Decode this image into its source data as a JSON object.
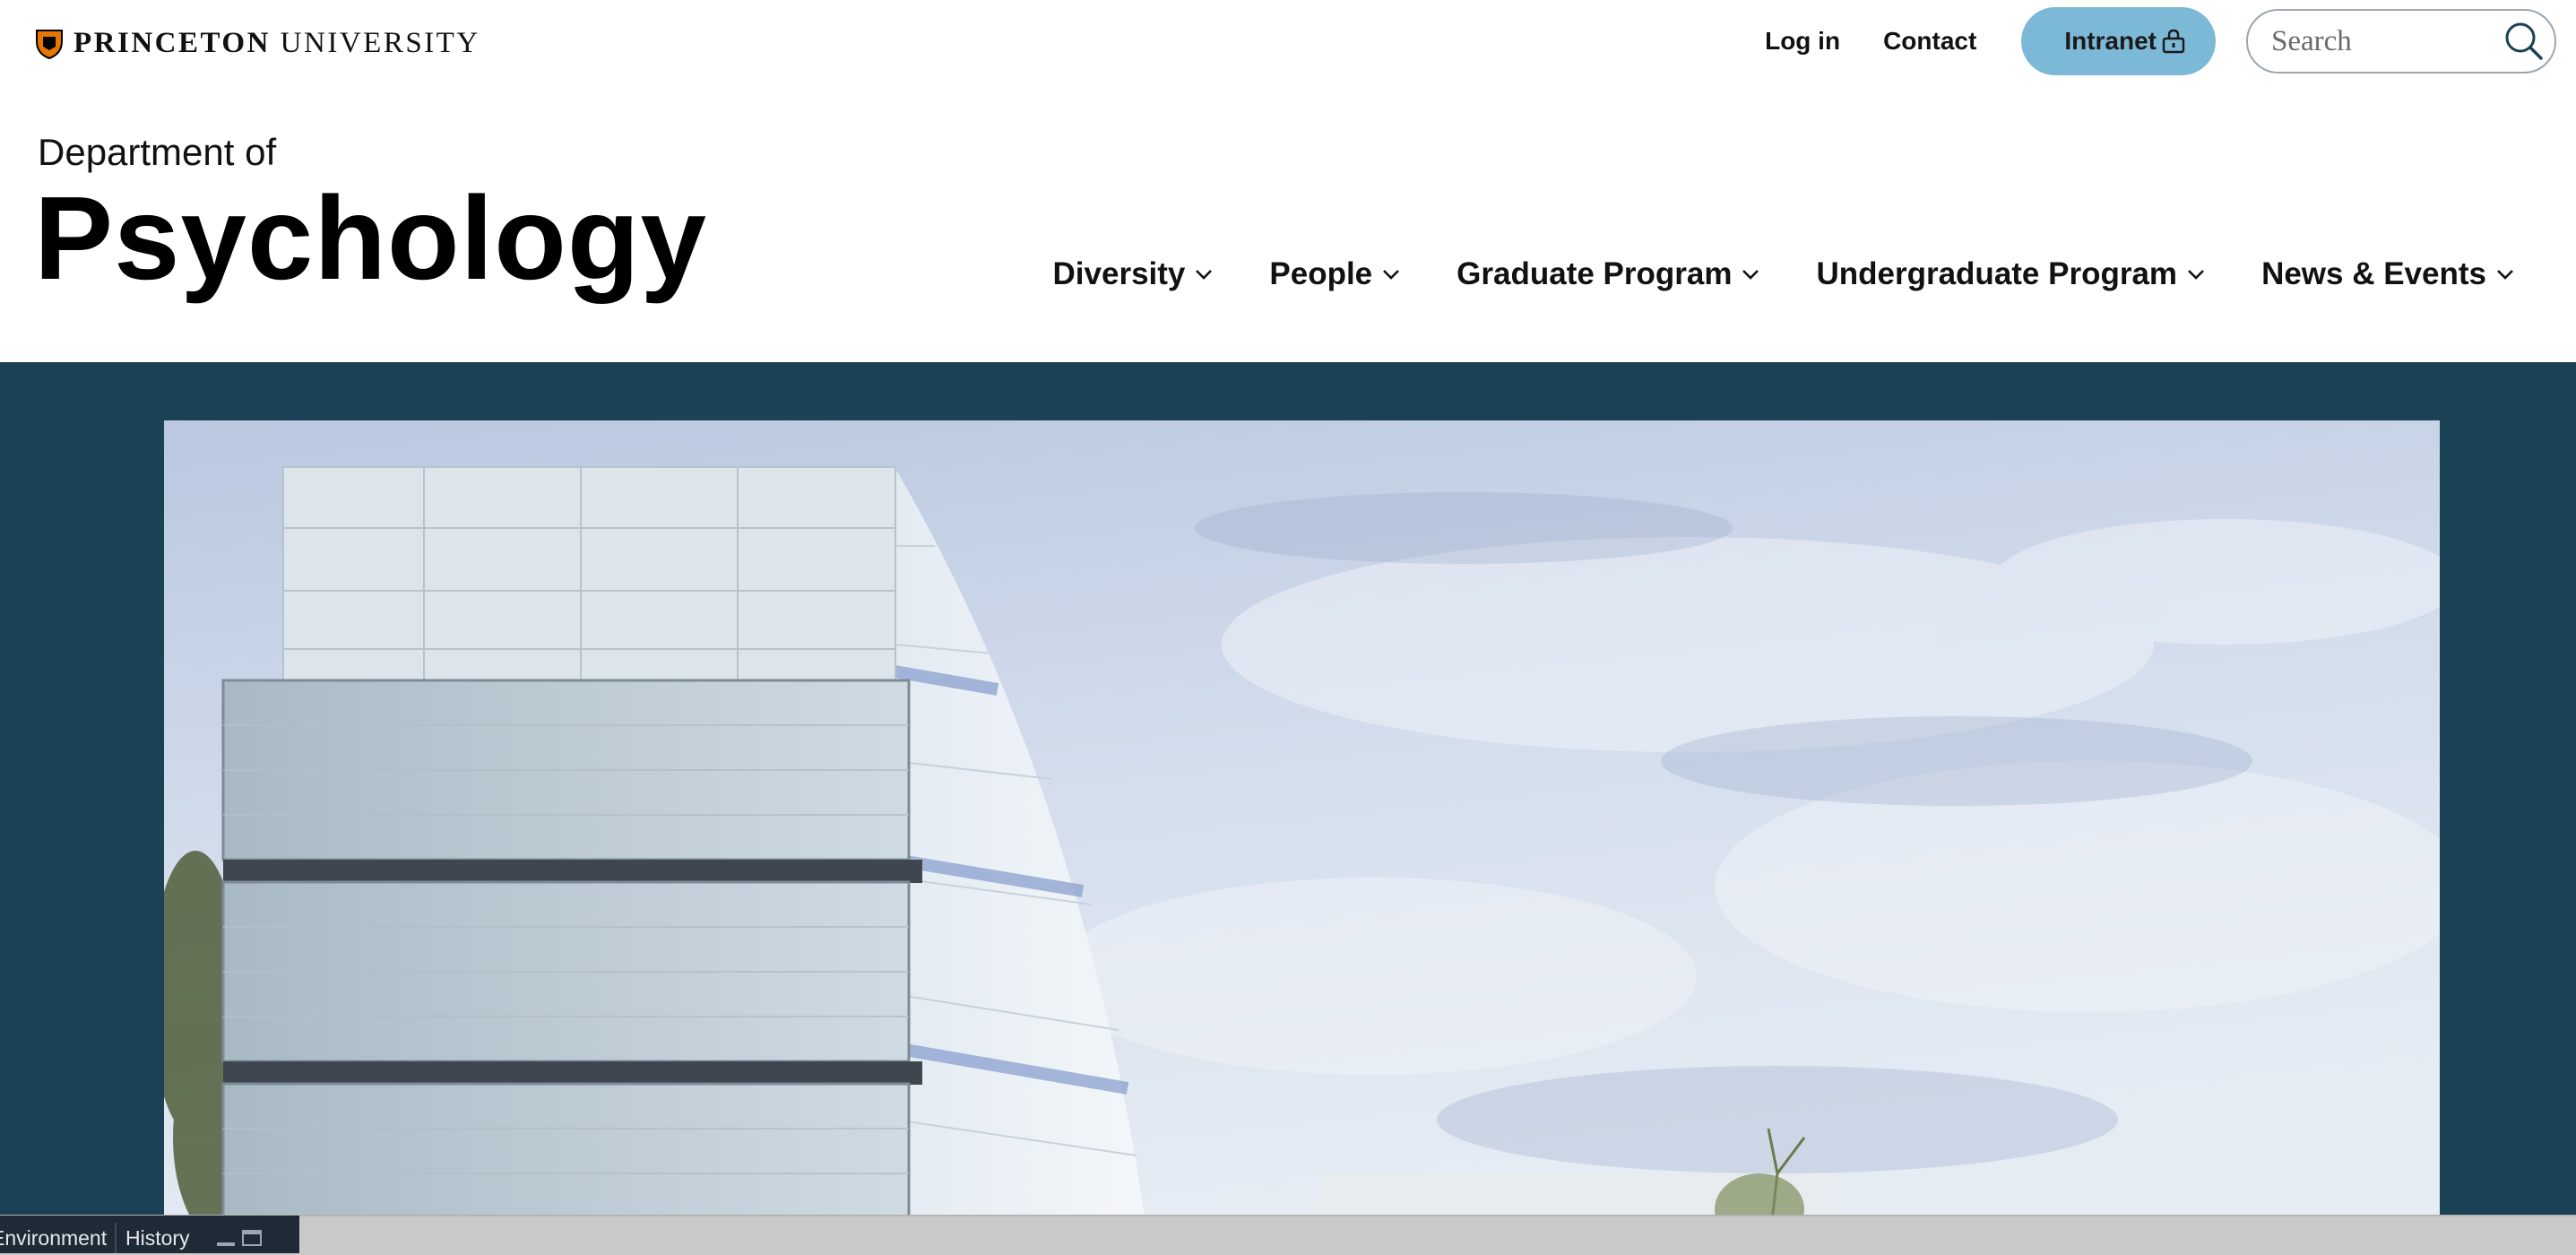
{
  "brand": {
    "part1": "PRINCETON",
    "part2": " UNIVERSITY",
    "shield_icon": "princeton-shield-icon",
    "colors": {
      "shield_orange": "#e77500",
      "shield_black": "#000000"
    }
  },
  "utility_nav": {
    "login_label": "Log in",
    "contact_label": "Contact",
    "intranet_label": "Intranet",
    "intranet_icon": "lock-icon",
    "search_placeholder": "Search",
    "search_icon": "search-icon"
  },
  "department": {
    "prefix": "Department of",
    "name": "Psychology"
  },
  "main_nav": {
    "items": [
      {
        "label": "Diversity",
        "icon": "chevron-down-icon"
      },
      {
        "label": "People",
        "icon": "chevron-down-icon"
      },
      {
        "label": "Graduate Program",
        "icon": "chevron-down-icon"
      },
      {
        "label": "Undergraduate Program",
        "icon": "chevron-down-icon"
      },
      {
        "label": "News & Events",
        "icon": "chevron-down-icon"
      }
    ]
  },
  "hero": {
    "background_color": "#1b4155",
    "accent_color": "#7cb9d6"
  },
  "dock": {
    "tabs": [
      {
        "label": "Environment"
      },
      {
        "label": "History"
      }
    ],
    "minimize_icon": "minimize-icon",
    "maximize_icon": "maximize-icon"
  }
}
